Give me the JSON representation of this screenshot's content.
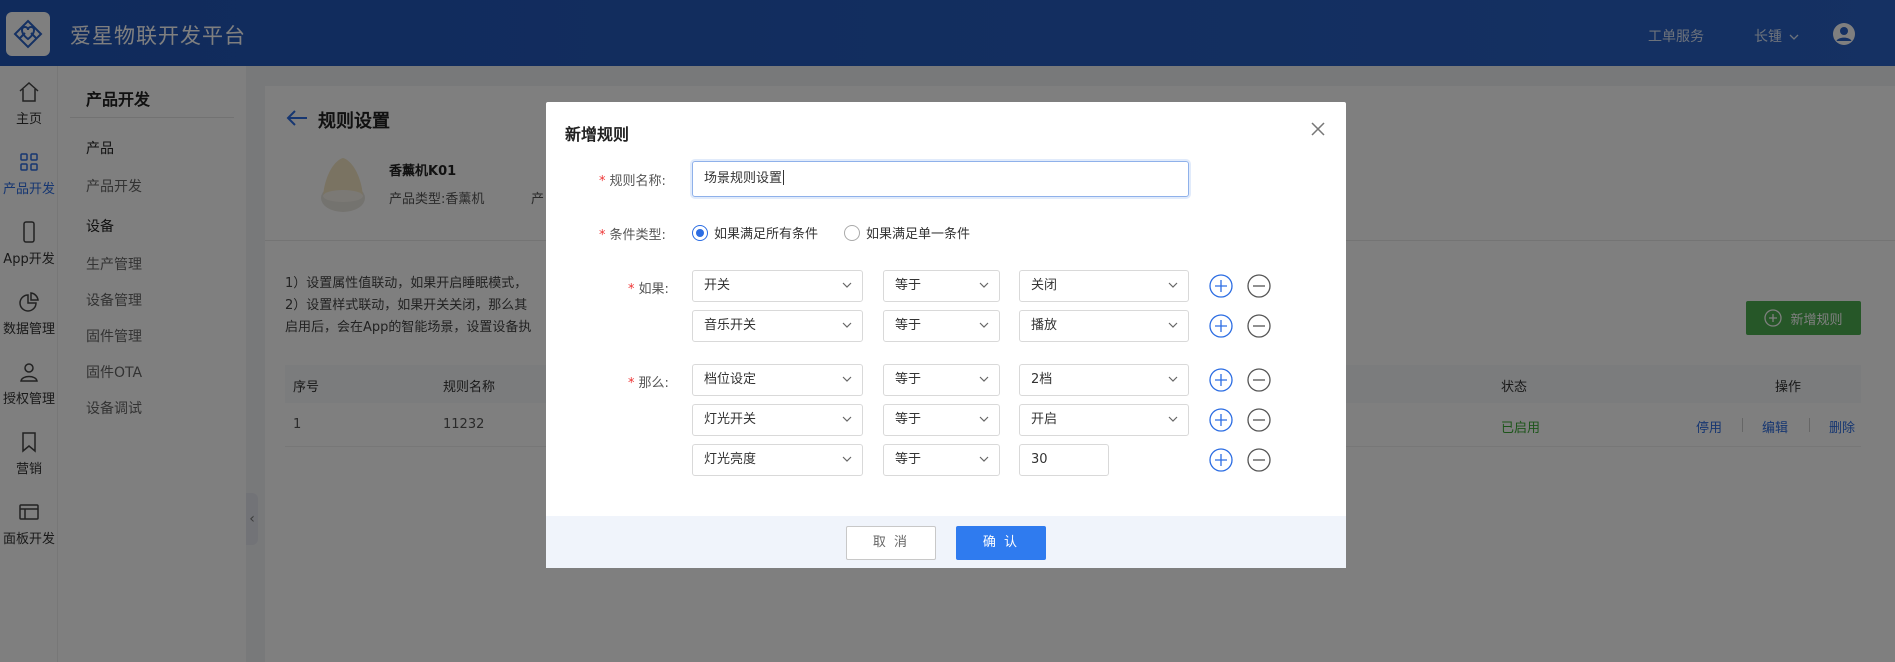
{
  "header": {
    "app_title": "爱星物联开发平台",
    "ticket_service": "工单服务",
    "user_name": "长锺",
    "accent_color": "#2156b8"
  },
  "icon_sidebar": {
    "items": [
      {
        "label": "主页",
        "icon": "home-icon"
      },
      {
        "label": "产品开发",
        "icon": "grid-icon",
        "active": true
      },
      {
        "label": "App开发",
        "icon": "phone-icon"
      },
      {
        "label": "数据管理",
        "icon": "pie-chart-icon"
      },
      {
        "label": "授权管理",
        "icon": "user-icon"
      },
      {
        "label": "营销",
        "icon": "bookmark-icon"
      },
      {
        "label": "面板开发",
        "icon": "panel-icon"
      }
    ]
  },
  "sub_sidebar": {
    "title": "产品开发",
    "group1": "产品",
    "item_product_dev": "产品开发",
    "group2": "设备",
    "item_production": "生产管理",
    "item_device_mgmt": "设备管理",
    "item_firmware": "固件管理",
    "item_ota": "固件OTA",
    "item_debug": "设备调试"
  },
  "page": {
    "title": "规则设置",
    "product_name": "香薰机K01",
    "product_type": "产品类型:香薰机",
    "product_more": "产",
    "desc_line1": "1）设置属性值联动，如果开启睡眠模式，",
    "desc_line2": "2）设置样式联动，如果开关关闭，那么其",
    "desc_line3": "启用后，会在App的智能场景，设置设备执",
    "new_rule_button": "新增规则",
    "table": {
      "headers": {
        "index": "序号",
        "name": "规则名称",
        "status": "状态",
        "ops": "操作"
      },
      "row": {
        "index": "1",
        "name": "11232",
        "status": "已启用",
        "disable": "停用",
        "edit": "编辑",
        "delete": "删除"
      }
    }
  },
  "modal": {
    "title": "新增规则",
    "name_label": "规则名称:",
    "name_value": "场景规则设置",
    "cond_label": "条件类型:",
    "radio_all": "如果满足所有条件",
    "radio_any": "如果满足单一条件",
    "radio_selected": "all",
    "if_label": "如果:",
    "then_label": "那么:",
    "if_rows": [
      {
        "prop": "开关",
        "op": "等于",
        "value": "关闭"
      },
      {
        "prop": "音乐开关",
        "op": "等于",
        "value": "播放"
      }
    ],
    "then_rows": [
      {
        "prop": "档位设定",
        "op": "等于",
        "value": "2档"
      },
      {
        "prop": "灯光开关",
        "op": "等于",
        "value": "开启"
      },
      {
        "prop": "灯光亮度",
        "op": "等于",
        "value": "30"
      }
    ],
    "cancel_button": "取 消",
    "confirm_button": "确 认"
  }
}
